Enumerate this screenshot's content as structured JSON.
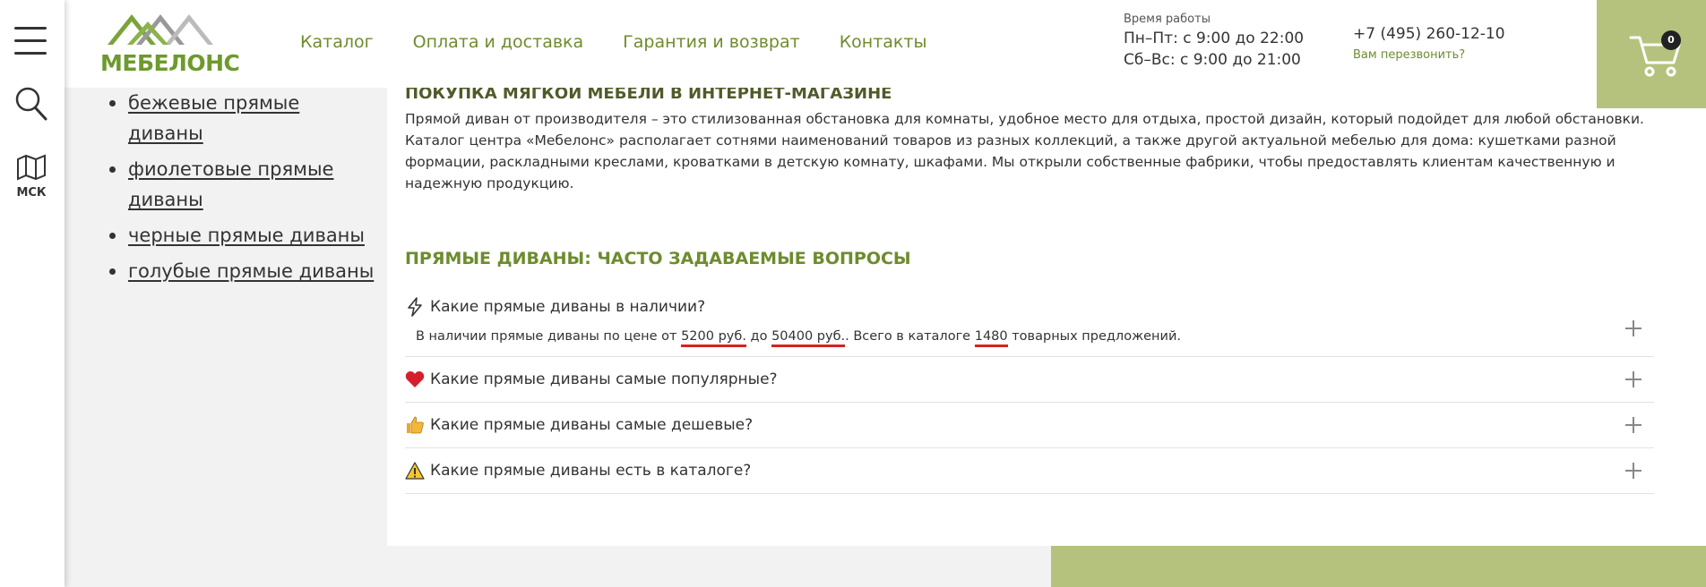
{
  "rail": {
    "city_label": "МСК"
  },
  "header": {
    "logo_text": "МЕБЕЛОНС",
    "nav": [
      "Каталог",
      "Оплата и доставка",
      "Гарантия и возврат",
      "Контакты"
    ],
    "hours_caption": "Время работы",
    "hours_weekdays": "Пн–Пт: с 9:00 до 22:00",
    "hours_weekend": "Сб–Вс: с 9:00 до 21:00",
    "phone": "+7 (495) 260-12-10",
    "callback": "Вам перезвонить?",
    "cart_count": "0",
    "brand_color": "#6d9a2d",
    "cart_bg": "#b5c27e"
  },
  "colors_list": [
    "бежевые прямые диваны",
    "фиолетовые прямые диваны",
    "черные прямые диваны",
    "голубые прямые диваны"
  ],
  "main": {
    "heading": "ПОКУПКА МЯГКОЙ МЕБЕЛИ В ИНТЕРНЕТ-МАГАЗИНЕ",
    "text": "Прямой диван от производителя – это стилизованная обстановка для комнаты, удобное место для отдыха, простой дизайн, который подойдет для любой обстановки. Каталог центра «Мебелонс» располагает сотнями наименований товаров из разных коллекций, а также другой актуальной мебелью для дома: кушетками разной формации, раскладными креслами, кроватками в детскую комнату, шкафами. Мы открыли собственные фабрики, чтобы предоставлять клиентам качественную и надежную продукцию."
  },
  "faq": {
    "title": "ПРЯМЫЕ ДИВАНЫ: ЧАСТО ЗАДАВАЕМЫЕ ВОПРОСЫ",
    "items": [
      {
        "icon": "lightning-icon",
        "question": "Какие прямые диваны в наличии?",
        "answer_prefix": "В наличии прямые диваны по цене от",
        "price_min": "5200 руб.",
        "answer_mid": "до",
        "price_max": "50400 руб.",
        "answer_mid2": ". Всего в каталоге",
        "count": "1480",
        "answer_suffix": "товарных предложений."
      },
      {
        "icon": "heart-icon",
        "question": "Какие прямые диваны самые популярные?"
      },
      {
        "icon": "thumbs-up-icon",
        "question": "Какие прямые диваны самые дешевые?"
      },
      {
        "icon": "warning-icon",
        "question": "Какие прямые диваны есть в каталоге?"
      }
    ]
  }
}
